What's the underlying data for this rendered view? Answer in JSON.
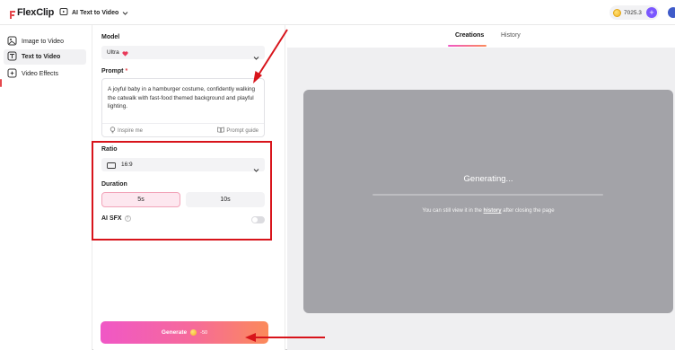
{
  "app": {
    "logo_text": "FlexClip",
    "tool_label": "AI Text to Video"
  },
  "header": {
    "credits": "7025.3"
  },
  "sidebar": {
    "items": [
      {
        "label": "Image to Video",
        "icon": "image-to-video-icon"
      },
      {
        "label": "Text to Video",
        "icon": "text-to-video-icon",
        "active": true
      },
      {
        "label": "Video Effects",
        "icon": "video-effects-icon"
      }
    ]
  },
  "form": {
    "model_label": "Model",
    "model_value": "Ultra",
    "prompt_label": "Prompt",
    "prompt_required": "*",
    "prompt_text": "A joyful baby in a hamburger costume, confidently walking the catwalk with fast-food themed background and playful lighting.",
    "inspire_label": "Inspire me",
    "guide_label": "Prompt guide",
    "ratio_label": "Ratio",
    "ratio_value": "16:9",
    "duration_label": "Duration",
    "duration_options": [
      "5s",
      "10s"
    ],
    "duration_selected": "5s",
    "sfx_label": "AI SFX",
    "sfx_help": "?",
    "sfx_enabled": false,
    "generate_label": "Generate",
    "generate_cost": "-50"
  },
  "main": {
    "tabs": [
      {
        "label": "Creations",
        "active": true
      },
      {
        "label": "History"
      }
    ],
    "status_title": "Generating...",
    "status_note_before": "You can still view it in the ",
    "status_note_link": "history",
    "status_note_after": " after closing the page"
  },
  "colors": {
    "accent_pink": "#f057c6",
    "accent_orange": "#fb8a5a",
    "annotation_red": "#d8141b",
    "card_gray": "#a3a3a8"
  }
}
